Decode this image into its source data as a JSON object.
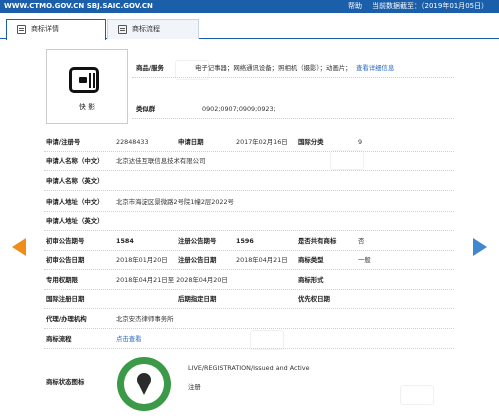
{
  "topbar": {
    "url": "WWW.CTMO.GOV.CN SBJ.SAIC.GOV.CN",
    "help": "帮助",
    "date_text": "当前数据截至：（2019年01月05日）"
  },
  "tabs": [
    {
      "label": "商标详情"
    },
    {
      "label": "商标流程"
    }
  ],
  "logo": {
    "caption": "快 影"
  },
  "goods": {
    "label": "商品/服务",
    "value": "电子记事器；网络通讯设备；照相机（摄影）；动画片；",
    "link": "查看详细信息"
  },
  "similar": {
    "label": "类似群",
    "value": "0902;0907;0909;0923;"
  },
  "rows": {
    "reg_no_label": "申请/注册号",
    "reg_no": "22848433",
    "app_date_label": "申请日期",
    "app_date": "2017年02月16日",
    "intl_class_label": "国际分类",
    "intl_class": "9",
    "applicant_cn_label": "申请人名称（中文）",
    "applicant_cn": "北京达佳互联信息技术有限公司",
    "applicant_en_label": "申请人名称（英文）",
    "addr_cn_label": "申请人地址（中文）",
    "addr_cn": "北京市海淀区景微路2号院1幢2层2022号",
    "addr_en_label": "申请人地址（英文）",
    "prelim_no_label": "初审公告期号",
    "prelim_no": "1584",
    "reg_notice_no_label": "注册公告期号",
    "reg_notice_no": "1596",
    "shared_label": "是否共有商标",
    "shared": "否",
    "prelim_date_label": "初审公告日期",
    "prelim_date": "2018年01月20日",
    "reg_notice_date_label": "注册公告日期",
    "reg_notice_date": "2018年04月21日",
    "mark_type_label": "商标类型",
    "mark_type": "一般",
    "exclusive_label": "专用权期限",
    "exclusive": "2018年04月21日至 2028年04月20日",
    "mark_form_label": "商标形式",
    "intl_reg_date_label": "国际注册日期",
    "later_date_label": "后期指定日期",
    "priority_date_label": "优先权日期",
    "agent_label": "代理/办理机构",
    "agent": "北京安杰律师事务所",
    "flow_label": "商标流程",
    "flow_link": "点击查看",
    "status_label": "商标状态图标",
    "status_en": "LIVE/REGISTRATION/Issued and Active",
    "status_cn": "注册"
  }
}
